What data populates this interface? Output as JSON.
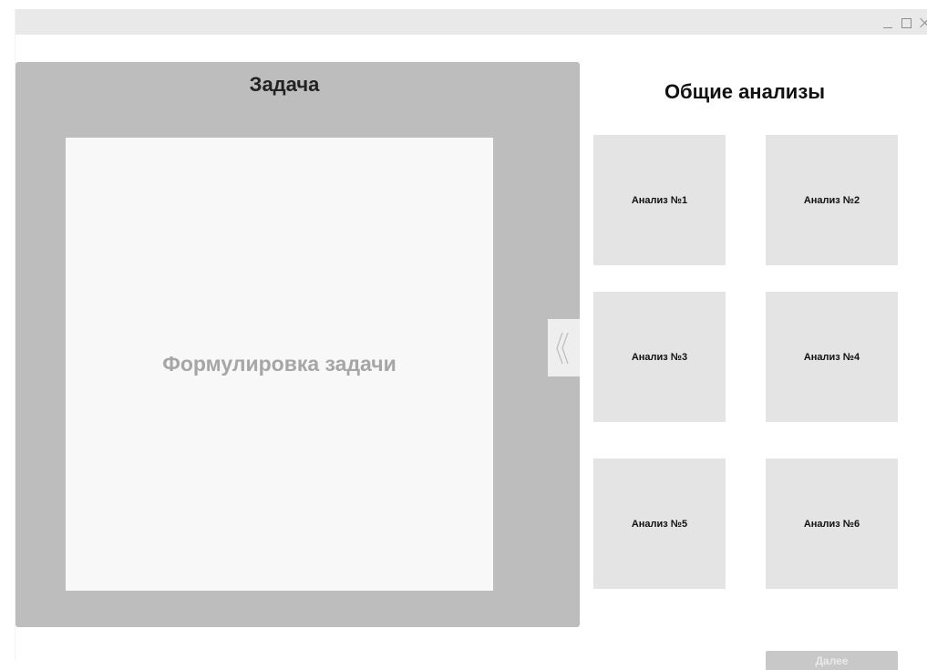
{
  "window": {
    "controls": [
      "minimize",
      "maximize",
      "close"
    ]
  },
  "task": {
    "title": "Задача",
    "formulation": "Формулировка задачи"
  },
  "analyses": {
    "title": "Общие анализы",
    "items": [
      {
        "label": "Анализ №1"
      },
      {
        "label": "Анализ №2"
      },
      {
        "label": "Анализ №3"
      },
      {
        "label": "Анализ №4"
      },
      {
        "label": "Анализ №5"
      },
      {
        "label": "Анализ №6"
      }
    ]
  },
  "icons": {
    "collapse": "double-chevron-left-icon"
  },
  "footer": {
    "next_label": "Далее"
  },
  "colors": {
    "panel": "#bdbdbd",
    "task_body": "#f8f8f8",
    "card": "#e4e4e4",
    "button": "#c8c8c8",
    "titlebar": "#e9e9e9"
  }
}
